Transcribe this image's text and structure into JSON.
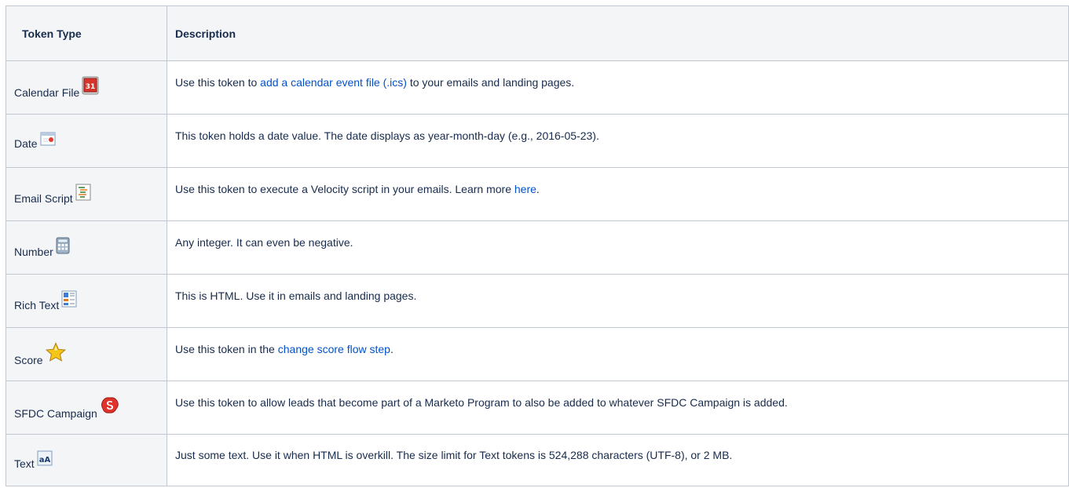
{
  "table": {
    "headers": {
      "type": "Token Type",
      "description": "Description"
    },
    "rows": [
      {
        "type": "Calendar File",
        "icon": "calendar-icon",
        "pre": "Use this token to ",
        "link": "add a calendar event file (.ics)",
        "post": " to your emails and landing pages."
      },
      {
        "type": "Date",
        "icon": "date-icon",
        "pre": "This token holds a date value. The date displays as year-month-day (e.g., 2016-05-23).",
        "link": "",
        "post": ""
      },
      {
        "type": "Email Script",
        "icon": "email-script-icon",
        "pre": "Use this token to execute a Velocity script in your emails. Learn more ",
        "link": "here",
        "post": "."
      },
      {
        "type": "Number",
        "icon": "calculator-icon",
        "pre": "Any integer. It can even be negative.",
        "link": "",
        "post": ""
      },
      {
        "type": "Rich Text",
        "icon": "rich-text-icon",
        "pre": "This is HTML. Use it in emails and landing pages.",
        "link": "",
        "post": ""
      },
      {
        "type": "Score",
        "icon": "star-icon",
        "pre": "Use this token in the ",
        "link": "change score flow step",
        "post": "."
      },
      {
        "type": "SFDC Campaign",
        "icon": "sfdc-campaign-icon",
        "pre": "Use this token to allow leads that become part of a Marketo Program to also be added to whatever SFDC Campaign is added.",
        "link": "",
        "post": ""
      },
      {
        "type": "Text",
        "icon": "text-icon",
        "pre": "Just some text. Use it when HTML is overkill. The size limit for Text tokens is 524,288 characters (UTF-8), or 2 MB.",
        "link": "",
        "post": ""
      }
    ]
  },
  "icon_glyphs": {
    "calendar_day": "31",
    "text_letters": "aA"
  },
  "colors": {
    "link": "#0052cc",
    "header_bg": "#f4f5f7",
    "border": "#c1c7d0"
  }
}
